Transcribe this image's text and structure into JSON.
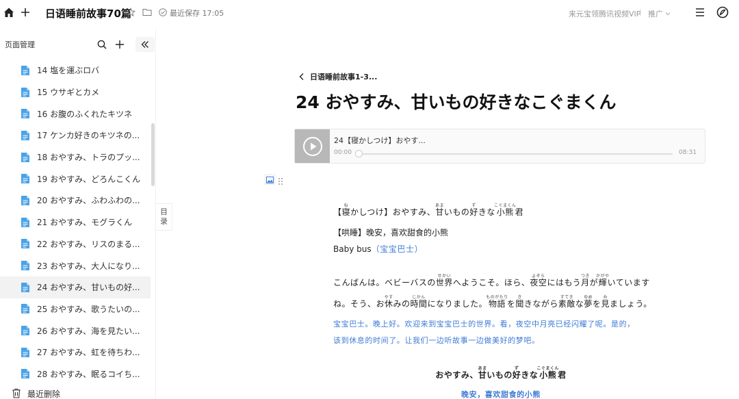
{
  "header": {
    "doc_title": "日语睡前故事70篇",
    "save_status": "最近保存 17:05",
    "vip_text": "来元宝领腾讯视频VIP",
    "separator": "|",
    "promo_label": "推广"
  },
  "sidebar": {
    "title": "页面管理",
    "items": [
      {
        "label": "14 塩を運ぶロバ"
      },
      {
        "label": "15 ウサギとカメ"
      },
      {
        "label": "16 お腹のふくれたキツネ"
      },
      {
        "label": "17 ケンカ好きのキツネの..."
      },
      {
        "label": "18 おやすみ、トラのプッ..."
      },
      {
        "label": "19 おやすみ、どろんこくん"
      },
      {
        "label": "20 おやすみ、ふわふわの..."
      },
      {
        "label": "21 おやすみ、モグラくん"
      },
      {
        "label": "22 おやすみ、リスのまる..."
      },
      {
        "label": "23 おやすみ、大人になり..."
      },
      {
        "label": "24 おやすみ、甘いもの好..."
      },
      {
        "label": "25 おやすみ、歌うたいの..."
      },
      {
        "label": "26 おやすみ、海を見たい..."
      },
      {
        "label": "27 おやすみ、虹を待ちわ..."
      },
      {
        "label": "28 おやすみ、眠るコイち..."
      }
    ],
    "active_index": 10,
    "footer_label": "最近删除"
  },
  "outline_tab": {
    "line1": "目",
    "line2": "录"
  },
  "main": {
    "breadcrumb": "日语睡前故事1-3...",
    "title": "24 おやすみ、甘いもの好きなこぐまくん",
    "audio": {
      "title": "24【寝かしつけ】おやす...",
      "current": "00:00",
      "duration": "08:31",
      "progress": 0
    },
    "article": {
      "l1": {
        "p1": "【",
        "k1": "寝",
        "r1": "ね",
        "p2": "かしつけ】おやすみ、",
        "k2": "甘",
        "r2": "あま",
        "p3": "いもの",
        "k3": "好",
        "r3": "ず",
        "p4": "きな",
        "k4": "小熊",
        "r4": "こぐまくん",
        "p5": "君"
      },
      "l2": "【哄睡】晚安，喜欢甜食的小熊",
      "l3a": "Baby bus",
      "l3b": "（宝宝巴士）",
      "l4": {
        "p1": "こんばんは。ベビーバスの",
        "k1": "世界",
        "r1": "せかい",
        "p2": "へようこそ。ほら、",
        "k2": "夜空",
        "r2": "よぞら",
        "p3": "にはもう",
        "k3": "月",
        "r3": "つき",
        "p4": "が",
        "k4": "輝",
        "r4": "かがや",
        "p5": "いています"
      },
      "l5": {
        "p1": "ね。そう、お",
        "k1": "休",
        "r1": "やす",
        "p2": "みの",
        "k2": "時間",
        "r2": "じかん",
        "p3": "になりました。",
        "k3": "物語",
        "r3": "ものがたり",
        "p4": "を",
        "k4": "聞",
        "r4": "き",
        "p5": "きながら",
        "k5": "素敵",
        "r5": "すてき",
        "p6": "な",
        "k6": "夢",
        "r6": "ゆめ",
        "p7": "を",
        "k7": "見",
        "r7": "み",
        "p8": "ましょう。"
      },
      "l6": "宝宝巴士。晚上好。欢迎来到宝宝巴士的世界。看，夜空中月亮已经闪耀了呢。是的，",
      "l7": "该到休息的时间了。让我们一边听故事一边做美好的梦吧。",
      "l8": {
        "p1": "おやすみ、",
        "k1": "甘",
        "r1": "あま",
        "p2": "いもの",
        "k2": "好",
        "r2": "ず",
        "p3": "きな",
        "k3": "小熊",
        "r3": "こぐまくん",
        "p4": "君"
      },
      "l9": "晚安，喜欢甜食的小熊"
    }
  },
  "colors": {
    "link_blue": "#3e7bd5",
    "doc_icon": "#4aa3e8"
  }
}
